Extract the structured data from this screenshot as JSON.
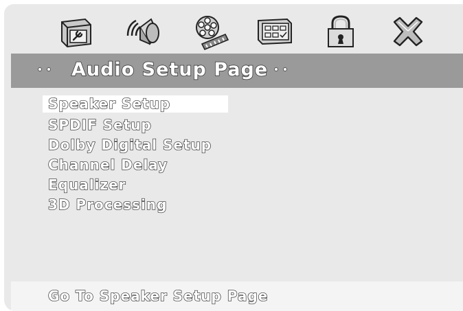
{
  "icons": [
    {
      "name": "system-setup-icon"
    },
    {
      "name": "audio-setup-icon"
    },
    {
      "name": "video-setup-icon"
    },
    {
      "name": "preference-setup-icon"
    },
    {
      "name": "password-setup-icon"
    },
    {
      "name": "exit-setup-icon"
    }
  ],
  "header": {
    "title": "Audio Setup Page"
  },
  "menu": {
    "items": [
      {
        "label": "Speaker Setup",
        "selected": true
      },
      {
        "label": "SPDIF Setup",
        "selected": false
      },
      {
        "label": "Dolby Digital Setup",
        "selected": false
      },
      {
        "label": "Channel Delay",
        "selected": false
      },
      {
        "label": "Equalizer",
        "selected": false
      },
      {
        "label": "3D Processing",
        "selected": false
      }
    ]
  },
  "status": {
    "text": "Go To Speaker Setup Page"
  },
  "colors": {
    "background": "#e9e9e9",
    "title_bar": "#9a9a9a",
    "highlight": "#ffffff",
    "text_outline": "#262626"
  }
}
